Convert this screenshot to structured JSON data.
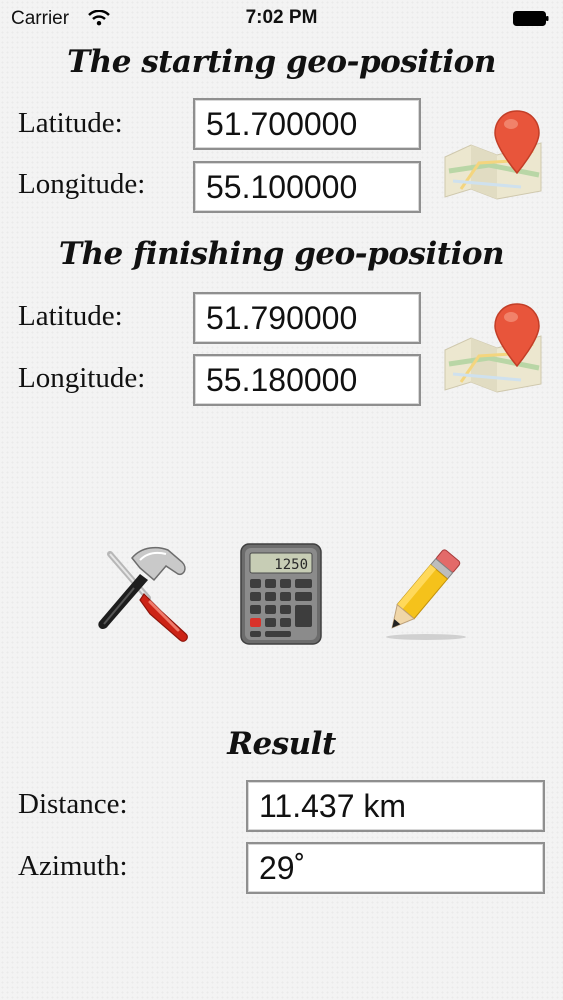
{
  "status": {
    "carrier": "Carrier",
    "time": "7:02 PM"
  },
  "start": {
    "title": "The starting geo-position",
    "lat_label": "Latitude:",
    "lat_value": "51.700000",
    "lon_label": "Longitude:",
    "lon_value": "55.100000"
  },
  "finish": {
    "title": "The finishing geo-position",
    "lat_label": "Latitude:",
    "lat_value": "51.790000",
    "lon_label": "Longitude:",
    "lon_value": "55.180000"
  },
  "tools": {
    "calculator_display": "1250",
    "icons": [
      "tools-icon",
      "calculator-icon",
      "pencil-icon"
    ]
  },
  "result": {
    "title": "Result",
    "distance_label": "Distance:",
    "distance_value": "11.437 km",
    "azimuth_label": "Azimuth:",
    "azimuth_value": "29˚"
  },
  "colors": {
    "pin": "#e8553b",
    "field_border": "#8f8f8f",
    "background": "#f3f3f3"
  }
}
